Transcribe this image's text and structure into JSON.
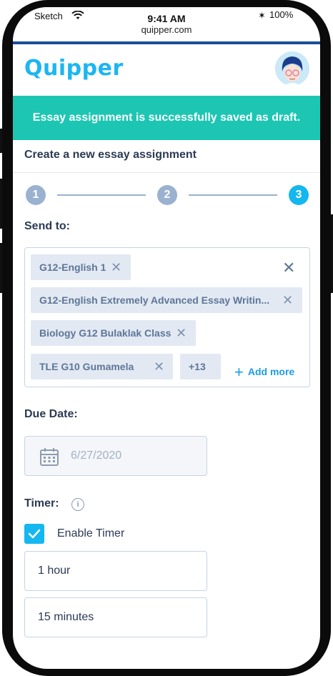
{
  "status_bar": {
    "carrier": "Sketch",
    "time": "9:41 AM",
    "url": "quipper.com",
    "battery": "100%"
  },
  "header": {
    "logo": "Quipper"
  },
  "banner": {
    "message": "Essay assignment is successfully saved as draft."
  },
  "page": {
    "title": "Create a new essay assignment"
  },
  "stepper": {
    "steps": [
      "1",
      "2",
      "3"
    ],
    "active": 3
  },
  "send_to": {
    "label": "Send to:",
    "chips": [
      "G12-English 1",
      "G12-English Extremely Advanced Essay Writin...",
      "Biology G12 Bulaklak Class",
      "TLE G10 Gumamela"
    ],
    "more_count": "+13",
    "add_more": "Add more"
  },
  "due_date": {
    "label": "Due Date:",
    "placeholder": "6/27/2020"
  },
  "timer": {
    "label": "Timer:",
    "enable_label": "Enable Timer",
    "enabled": true,
    "hours": "1 hour",
    "minutes": "15 minutes"
  },
  "colors": {
    "brand": "#1cb6f0",
    "banner": "#1cc6b3",
    "chip_bg": "#e2e9f3",
    "text": "#2b3a55",
    "step_inactive": "#9ab1cf"
  }
}
